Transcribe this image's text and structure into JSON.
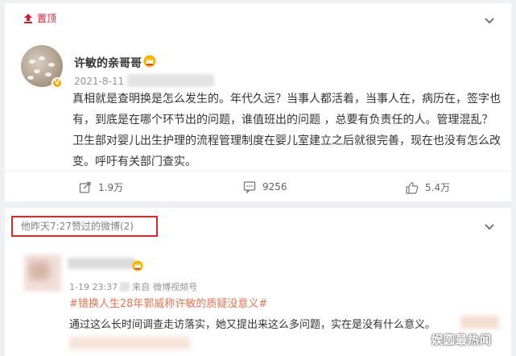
{
  "pinned_post": {
    "pin_label": "置顶",
    "username": "许敏的亲哥哥",
    "date": "2021-8-11",
    "text": "真相就是查明换是怎么发生的。年代久远？当事人都活着，当事人在，病历在，签字也有，到底是在哪个环节出的问题，谁值班出的问题 ，总要有负责任的人。管理混乱？卫生部对婴儿出生护理的流程管理制度在婴儿室建立之后就很完善，现在也没有怎么改变。呼吁有关部门查实。",
    "actions": {
      "repost_count": "1.9万",
      "comment_count": "9256",
      "like_count": "5.4万"
    },
    "icons": [
      "pin-icon",
      "chevron-down-icon",
      "verified-badge-icon",
      "crown-icon",
      "repost-icon",
      "comment-icon",
      "like-icon"
    ]
  },
  "liked_section": {
    "title": "他昨天7:27赞过的微博(2)",
    "post": {
      "time": "1-19 23:37",
      "source_prefix": "来自",
      "source": "微博视频号",
      "hashtag": "#错换人生28年郭威称许敏的质疑没意义#",
      "text": "通过这么长时间调查走访落实，她又提出来这么多问题，实在是没有什么意义。"
    }
  },
  "watermark": "娱圆最热闻",
  "colors": {
    "accent_red": "#e6162d",
    "hashtag_orange": "#eb7350",
    "highlight_box": "#e8232c"
  }
}
